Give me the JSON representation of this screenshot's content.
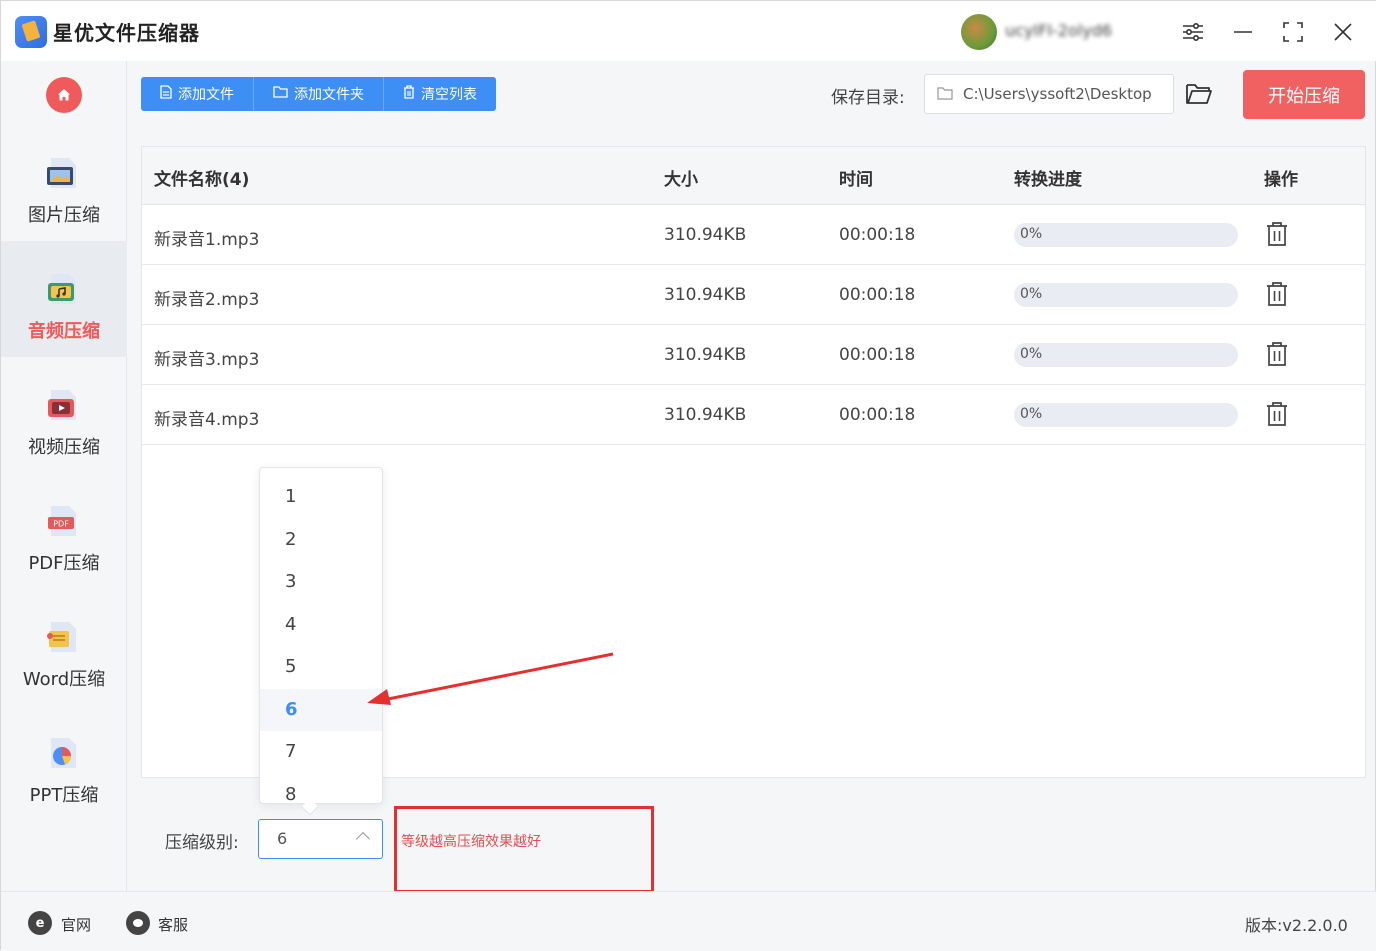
{
  "app": {
    "title": "星优文件压缩器",
    "username": "ucyIFI-2olyd6"
  },
  "sidebar": {
    "items": [
      {
        "label": "图片压缩",
        "icon": "image-file-icon"
      },
      {
        "label": "音频压缩",
        "icon": "audio-file-icon",
        "active": true
      },
      {
        "label": "视频压缩",
        "icon": "video-file-icon"
      },
      {
        "label": "PDF压缩",
        "icon": "pdf-file-icon"
      },
      {
        "label": "Word压缩",
        "icon": "word-file-icon"
      },
      {
        "label": "PPT压缩",
        "icon": "ppt-file-icon"
      }
    ]
  },
  "toolbar": {
    "add_file": "添加文件",
    "add_folder": "添加文件夹",
    "clear_list": "清空列表"
  },
  "save": {
    "label": "保存目录:",
    "path": "C:\\Users\\yssoft2\\Desktop",
    "start_label": "开始压缩"
  },
  "table": {
    "headers": {
      "name": "文件名称(4)",
      "size": "大小",
      "time": "时间",
      "progress": "转换进度",
      "action": "操作"
    },
    "rows": [
      {
        "name": "新录音1.mp3",
        "size": "310.94KB",
        "time": "00:00:18",
        "progress_text": "0%",
        "progress": 0
      },
      {
        "name": "新录音2.mp3",
        "size": "310.94KB",
        "time": "00:00:18",
        "progress_text": "0%",
        "progress": 0
      },
      {
        "name": "新录音3.mp3",
        "size": "310.94KB",
        "time": "00:00:18",
        "progress_text": "0%",
        "progress": 0
      },
      {
        "name": "新录音4.mp3",
        "size": "310.94KB",
        "time": "00:00:18",
        "progress_text": "0%",
        "progress": 0
      }
    ]
  },
  "compression": {
    "label": "压缩级别:",
    "value": "6",
    "options": [
      "1",
      "2",
      "3",
      "4",
      "5",
      "6",
      "7",
      "8"
    ],
    "hint": "等级越高压缩效果越好"
  },
  "statusbar": {
    "website": "官网",
    "support": "客服",
    "version": "版本:v2.2.0.0"
  },
  "colors": {
    "accent": "#3d8ef5",
    "danger": "#f26161",
    "annotation": "#e53030"
  }
}
